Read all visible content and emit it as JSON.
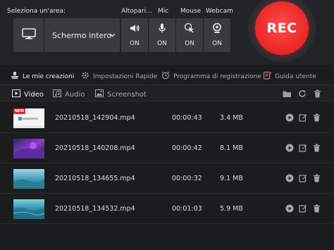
{
  "header": {
    "area_label": "Seleziona un'area:",
    "area_select_value": "Schermo intero",
    "channels": [
      {
        "label": "Altopari...",
        "state": "ON",
        "icon": "speaker-icon"
      },
      {
        "label": "Mic",
        "state": "ON",
        "icon": "microphone-icon"
      },
      {
        "label": "Mouse",
        "state": "ON",
        "icon": "mouse-pointer-icon"
      },
      {
        "label": "Webcam",
        "state": "ON",
        "icon": "webcam-icon"
      }
    ],
    "rec_label": "REC"
  },
  "links": {
    "items": [
      {
        "label": "Le mie creazioni",
        "icon": "creations-icon"
      },
      {
        "label": "Impostazioni Rapide",
        "icon": "gear-icon"
      },
      {
        "label": "Programma di registrazione",
        "icon": "alarm-clock-icon"
      },
      {
        "label": "Guida utente",
        "icon": "guide-icon"
      }
    ]
  },
  "tabs": {
    "items": [
      {
        "label": "Video",
        "icon": "video-icon"
      },
      {
        "label": "Audio",
        "icon": "music-icon"
      },
      {
        "label": "Screenshot",
        "icon": "image-icon"
      }
    ]
  },
  "files": [
    {
      "name": "20210518_142904.mp4",
      "duration": "00:00:43",
      "size": "3.4 MB",
      "badge": "NEW"
    },
    {
      "name": "20210518_140208.mp4",
      "duration": "00:00:42",
      "size": "8.1 MB"
    },
    {
      "name": "20210518_134655.mp4",
      "duration": "00:00:32",
      "size": "9.1 MB"
    },
    {
      "name": "20210518_134532.mp4",
      "duration": "00:01:03",
      "size": "5.9 MB"
    }
  ],
  "colors": {
    "accent": "#ec2b2b",
    "panel": "#3a3b3f",
    "background": "#1b1c1e"
  }
}
